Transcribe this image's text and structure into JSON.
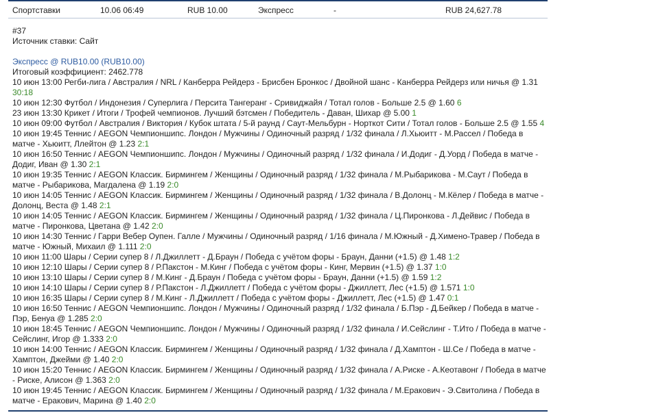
{
  "summary": {
    "type": "Спортставки",
    "datetime": "10.06 06:49",
    "stake": "RUB 10.00",
    "bet_kind": "Экспресс",
    "dash": "-",
    "payout": "RUB 24,627.78"
  },
  "bet": {
    "number": "#37",
    "source": "Источник ставки: Сайт",
    "express": "Экспресс @ RUB10.00 (RUB10.00)",
    "total_odds": "Итоговый коэффициент: 2462.778"
  },
  "colors": {
    "accent_line": "#1f3f6e",
    "express_text": "#2c5aa0",
    "score_text": "#3a8a2a"
  },
  "selections": [
    {
      "text": "10 июн 13:00 Регби-лига / Австралия / NRL / Канберра Рейдерз - Брисбен Бронкос / Двойной шанс - Канберра Рейдерз или ничья @ 1.31",
      "score": "30:18"
    },
    {
      "text": "10 июн 12:30 Футбол / Индонезия / Суперлига / Персита Тангеранг - Сривиджайя / Тотал голов - Больше 2.5 @ 1.60",
      "score": "6"
    },
    {
      "text": "23 июн 13:30 Крикет / Итоги / Трофей чемпионов. Лучший бэтсмен / Победитель - Даван, Шихар @ 5.00",
      "score": "1"
    },
    {
      "text": "10 июн 09:00 Футбол / Австралия / Виктория / Кубок штата / 5-й раунд / Саут-Мельбурн - Норткот Сити / Тотал голов - Больше 2.5 @ 1.55",
      "score": "4"
    },
    {
      "text": "10 июн 19:45 Теннис / AEGON Чемпионшипс. Лондон / Мужчины / Одиночный разряд / 1/32 финала / Л.Хьюитт - М.Рассел / Победа в матче - Хьюитт, Ллейтон @ 1.23",
      "score": "2:1"
    },
    {
      "text": "10 июн 16:50 Теннис / AEGON Чемпионшипс. Лондон / Мужчины / Одиночный разряд / 1/32 финала / И.Додиг - Д.Уорд / Победа в матче - Додиг, Иван @ 1.30",
      "score": "2:1"
    },
    {
      "text": "10 июн 19:35 Теннис / AEGON Классик. Бирмингем / Женщины / Одиночный разряд / 1/32 финала / М.Рыбарикова - М.Саут / Победа в матче - Рыбарикова, Магдалена @ 1.19",
      "score": "2:0"
    },
    {
      "text": "10 июн 14:05 Теннис / AEGON Классик. Бирмингем / Женщины / Одиночный разряд / 1/32 финала / В.Долонц - М.Кёлер / Победа в матче - Долонц, Веста @ 1.48",
      "score": "2:1"
    },
    {
      "text": "10 июн 14:05 Теннис / AEGON Классик. Бирмингем / Женщины / Одиночный разряд / 1/32 финала / Ц.Пиронкова - Л.Дейвис / Победа в матче - Пиронкова, Цветана @ 1.42",
      "score": "2:0"
    },
    {
      "text": "10 июн 14:30 Теннис / Гарри Вебер Оупен. Галле / Мужчины / Одиночный разряд / 1/16 финала / М.Южный - Д.Химено-Травер / Победа в матче - Южный, Михаил @ 1.111",
      "score": "2:0"
    },
    {
      "text": "10 июн 11:00 Шары / Серии супер 8 / Л.Джиллетт - Д.Браун / Победа с учётом форы - Браун, Данни (+1.5) @ 1.48",
      "score": "1:2"
    },
    {
      "text": "10 июн 12:10 Шары / Серии супер 8 / Р.Пакстон - М.Кинг / Победа с учётом форы - Кинг, Мервин (+1.5) @ 1.37",
      "score": "1:0"
    },
    {
      "text": "10 июн 13:10 Шары / Серии супер 8 / М.Кинг - Д.Браун / Победа с учётом форы - Браун, Данни (+1.5) @ 1.59",
      "score": "1:2"
    },
    {
      "text": "10 июн 14:10 Шары / Серии супер 8 / Р.Пакстон - Л.Джиллетт / Победа с учётом форы - Джиллетт, Лес (+1.5) @ 1.571",
      "score": "1:0"
    },
    {
      "text": "10 июн 16:35 Шары / Серии супер 8 / М.Кинг - Л.Джиллетт / Победа с учётом форы - Джиллетт, Лес (+1.5) @ 1.47",
      "score": "0:1"
    },
    {
      "text": "10 июн 16:50 Теннис / AEGON Чемпионшипс. Лондон / Мужчины / Одиночный разряд / 1/32 финала / Б.Пэр - Д.Бейкер / Победа в матче - Пэр, Бенуа @ 1.285",
      "score": "2:0"
    },
    {
      "text": "10 июн 18:45 Теннис / AEGON Чемпионшипс. Лондон / Мужчины / Одиночный разряд / 1/32 финала / И.Сейслинг - Т.Ито / Победа в матче - Сейслинг, Игор @ 1.333",
      "score": "2:0"
    },
    {
      "text": "10 июн 14:00 Теннис / AEGON Классик. Бирмингем / Женщины / Одиночный разряд / 1/32 финала / Д.Хамптон - Ш.Се / Победа в матче - Хамптон, Джейми @ 1.40",
      "score": "2:0"
    },
    {
      "text": "10 июн 15:20 Теннис / AEGON Классик. Бирмингем / Женщины / Одиночный разряд / 1/32 финала / А.Риске - А.Кеотавонг / Победа в матче - Риске, Алисон @ 1.363",
      "score": "2:0"
    },
    {
      "text": "10 июн 19:45 Теннис / AEGON Классик. Бирмингем / Женщины / Одиночный разряд / 1/32 финала / М.Еракович - Э.Свитолина / Победа в матче - Еракович, Марина @ 1.40",
      "score": "2:0"
    }
  ]
}
